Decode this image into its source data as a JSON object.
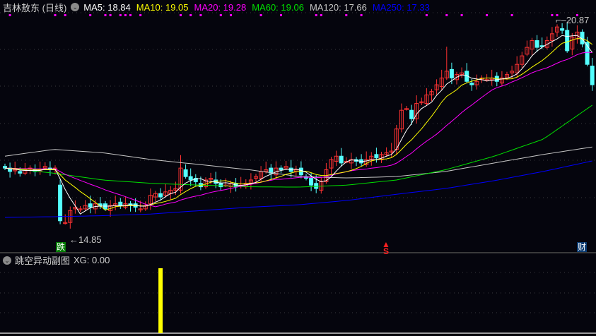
{
  "header": {
    "title": "吉林敖东 (日线)",
    "ma": [
      {
        "label": "MA5: 18.84",
        "color": "#ffffff"
      },
      {
        "label": "MA10: 19.05",
        "color": "#ffff00"
      },
      {
        "label": "MA20: 19.28",
        "color": "#ff00ff"
      },
      {
        "label": "MA60: 19.06",
        "color": "#00e000"
      },
      {
        "label": "MA120: 17.66",
        "color": "#c8c8c8"
      },
      {
        "label": "MA250: 17.33",
        "color": "#0000ff"
      }
    ]
  },
  "markers": {
    "low_label": "14.85",
    "high_label": "20.87",
    "drop_tag": "跌",
    "sell_tag": "S",
    "finance_tag": "财"
  },
  "sub_panel": {
    "title": "跳空异动副图",
    "value_label": "XG: 0.00"
  },
  "colors": {
    "up": "#ff3232",
    "down": "#54ffff",
    "sub_bar": "#ffff00",
    "signal_dot": "#ff00ff"
  },
  "chart_data": {
    "type": "candlestick",
    "price_range": [
      14.85,
      20.87
    ],
    "close": [
      16.55,
      16.45,
      16.5,
      16.4,
      16.5,
      16.55,
      16.45,
      16.5,
      16.6,
      16.5,
      16.55,
      15.0,
      14.95,
      15.3,
      15.4,
      15.35,
      15.45,
      15.4,
      15.5,
      15.45,
      15.35,
      15.45,
      15.5,
      15.45,
      15.5,
      15.45,
      15.4,
      15.35,
      15.45,
      15.75,
      15.8,
      15.7,
      15.85,
      15.9,
      15.95,
      16.55,
      16.3,
      16.2,
      16.15,
      16.0,
      16.2,
      16.25,
      16.1,
      16.0,
      16.05,
      16.1,
      16.0,
      16.05,
      16.1,
      16.2,
      16.3,
      16.45,
      16.5,
      16.4,
      16.55,
      16.5,
      16.6,
      16.45,
      16.5,
      16.35,
      16.25,
      16.05,
      15.95,
      16.15,
      16.5,
      16.8,
      16.9,
      16.7,
      16.75,
      16.8,
      16.75,
      16.7,
      16.8,
      16.9,
      16.85,
      16.95,
      17.0,
      17.05,
      17.7,
      18.25,
      18.3,
      18.0,
      18.45,
      18.5,
      18.7,
      18.8,
      19.0,
      19.2,
      19.4,
      19.2,
      19.3,
      19.35,
      19.1,
      19.0,
      19.1,
      19.2,
      19.15,
      19.2,
      19.1,
      19.2,
      19.3,
      19.4,
      19.6,
      19.85,
      20.1,
      20.3,
      20.1,
      20.15,
      20.3,
      20.5,
      20.7,
      20.6,
      20.0,
      20.4,
      20.55,
      20.2,
      19.6,
      19.0
    ],
    "ma60": [
      16.55,
      16.4,
      16.2,
      16.1,
      16.05,
      16.0,
      15.99,
      16.05,
      16.2,
      16.5,
      16.9,
      17.4,
      18.4
    ],
    "ma120": [
      16.9,
      17.1,
      17.0,
      16.8,
      16.65,
      16.5,
      16.3,
      16.26,
      16.3,
      16.45,
      16.7,
      16.95,
      17.17
    ],
    "ma250": [
      15.1,
      15.12,
      15.15,
      15.2,
      15.3,
      15.4,
      15.47,
      15.6,
      15.78,
      15.95,
      16.18,
      16.45,
      16.76
    ],
    "signal_bars": [
      1,
      10,
      12,
      17,
      20,
      21,
      23,
      24,
      25,
      27,
      35,
      37,
      39,
      43,
      45,
      51,
      55,
      62,
      63,
      68,
      71,
      84,
      88,
      91,
      96,
      101,
      109,
      110,
      114
    ],
    "xg_bars": [
      31
    ],
    "xg_value": 1
  }
}
